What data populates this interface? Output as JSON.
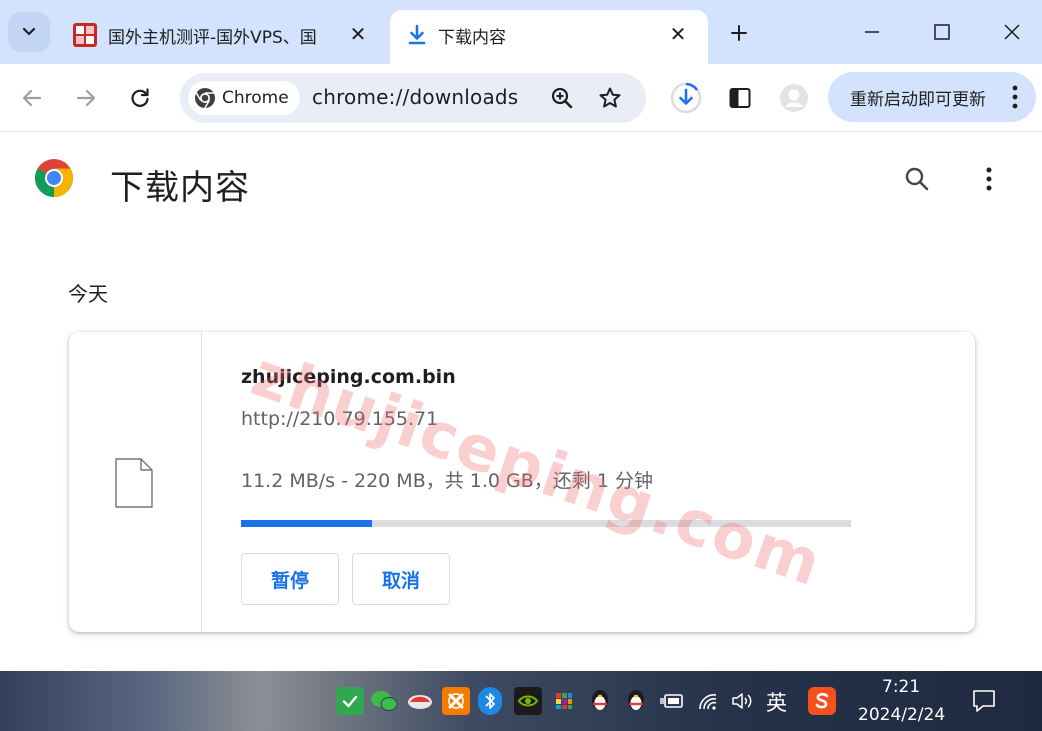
{
  "tabs": [
    {
      "title": "国外主机测评-国外VPS、国",
      "active": false
    },
    {
      "title": "下载内容",
      "active": true
    }
  ],
  "toolbar": {
    "chip_label": "Chrome",
    "url": "chrome://downloads",
    "update_label": "重新启动即可更新"
  },
  "page": {
    "title": "下载内容",
    "date_group": "今天"
  },
  "download": {
    "filename": "zhujiceping.com.bin",
    "source": "http://210.79.155.71",
    "status": "11.2 MB/s - 220 MB，共 1.0 GB，还剩 1 分钟",
    "progress_percent": 21.5,
    "pause_label": "暂停",
    "cancel_label": "取消"
  },
  "watermark": "zhujiceping.com",
  "taskbar": {
    "ime": "英",
    "time": "7:21",
    "date": "2024/2/24"
  },
  "colors": {
    "accent": "#1a73e8",
    "tabstrip": "#d3e3fd",
    "omnibox": "#e9eef6"
  }
}
